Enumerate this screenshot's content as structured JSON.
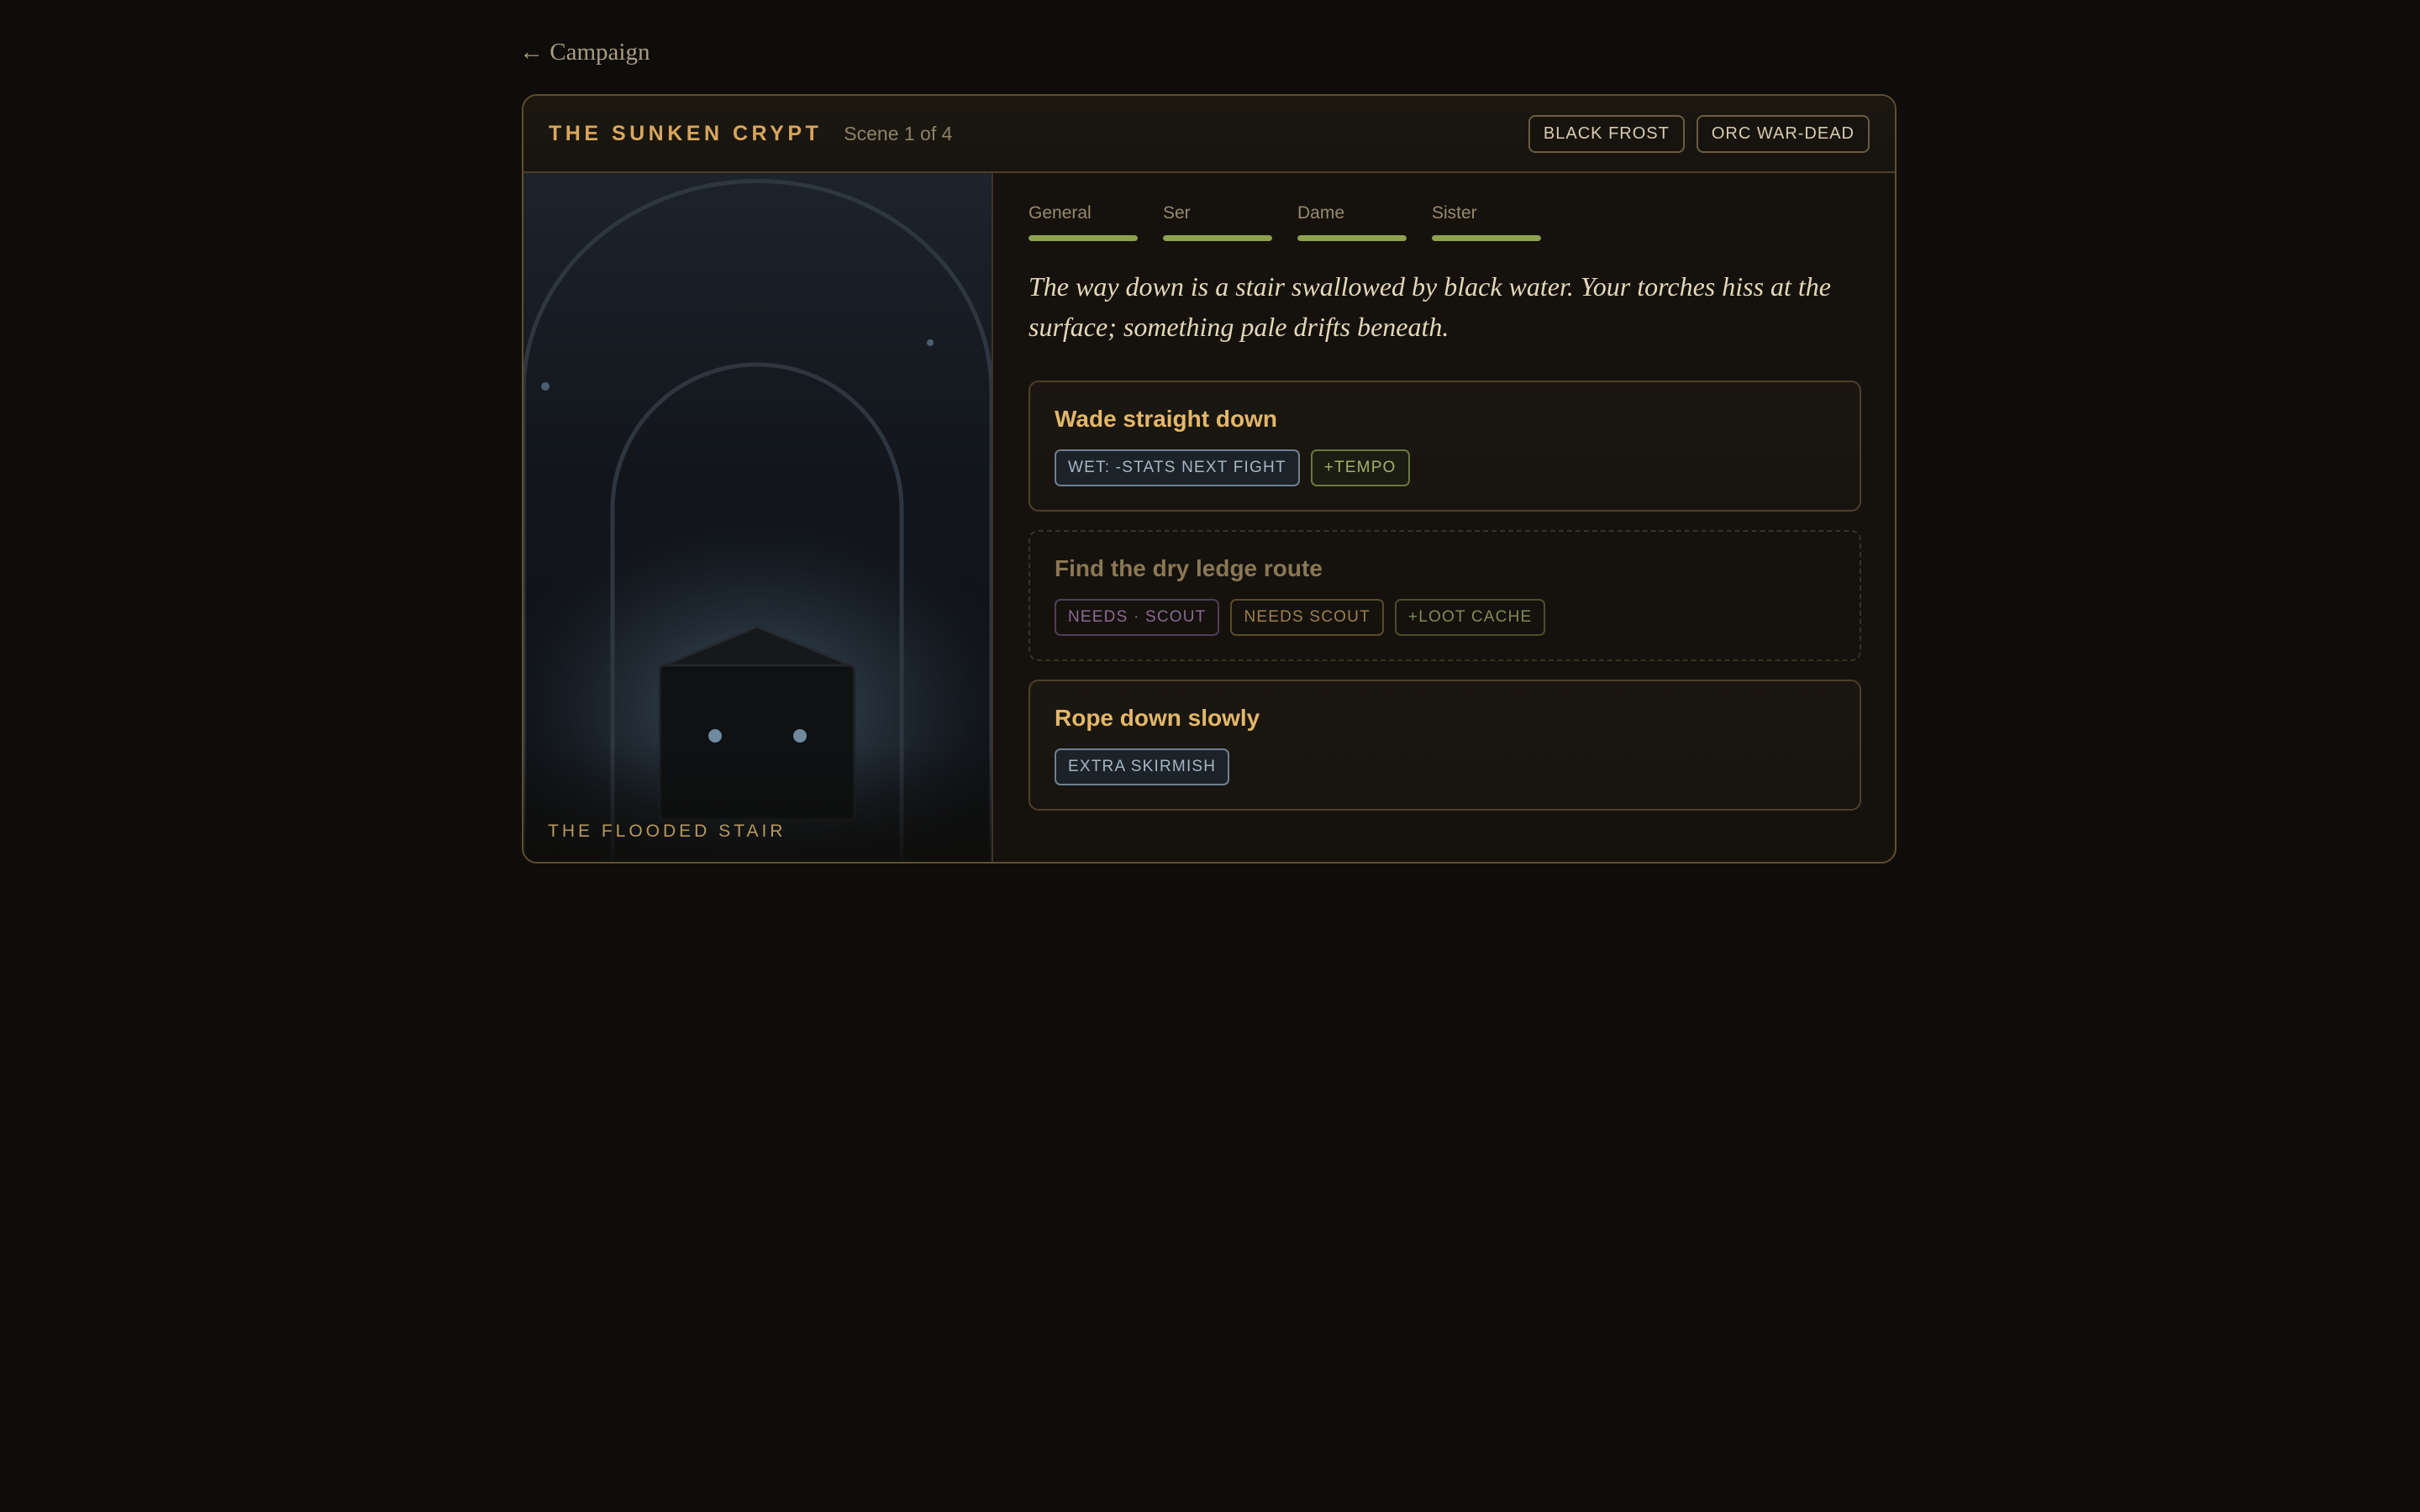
{
  "nav": {
    "back_label": "← Campaign"
  },
  "header": {
    "title": "THE SUNKEN CRYPT",
    "scene": "Scene 1 of 4",
    "enemy_tags": [
      "BLACK FROST",
      "ORC WAR-DEAD"
    ]
  },
  "scene_art": {
    "label": "THE FLOODED STAIR"
  },
  "party": [
    {
      "name": "General",
      "hp_fraction": 1.0
    },
    {
      "name": "Ser",
      "hp_fraction": 1.0
    },
    {
      "name": "Dame",
      "hp_fraction": 1.0
    },
    {
      "name": "Sister",
      "hp_fraction": 1.0
    }
  ],
  "narrative": "The way down is a stair swallowed by black water. Your torches hiss at the surface; something pale drifts beneath.",
  "choices": [
    {
      "title": "Wade straight down",
      "locked": false,
      "badges": [
        {
          "text": "WET: -STATS NEXT FIGHT",
          "kind": "cost"
        },
        {
          "text": "+TEMPO",
          "kind": "gain"
        }
      ]
    },
    {
      "title": "Find the dry ledge route",
      "locked": true,
      "badges": [
        {
          "text": "NEEDS · SCOUT",
          "kind": "need-class"
        },
        {
          "text": "NEEDS SCOUT",
          "kind": "need-role"
        },
        {
          "text": "+LOOT CACHE",
          "kind": "gain-dim"
        }
      ]
    },
    {
      "title": "Rope down slowly",
      "locked": false,
      "badges": [
        {
          "text": "EXTRA SKIRMISH",
          "kind": "cost"
        }
      ]
    }
  ],
  "colors": {
    "accent_gold": "#d8a65c",
    "hp_green": "#8da14f",
    "background": "#0e0d0b"
  }
}
